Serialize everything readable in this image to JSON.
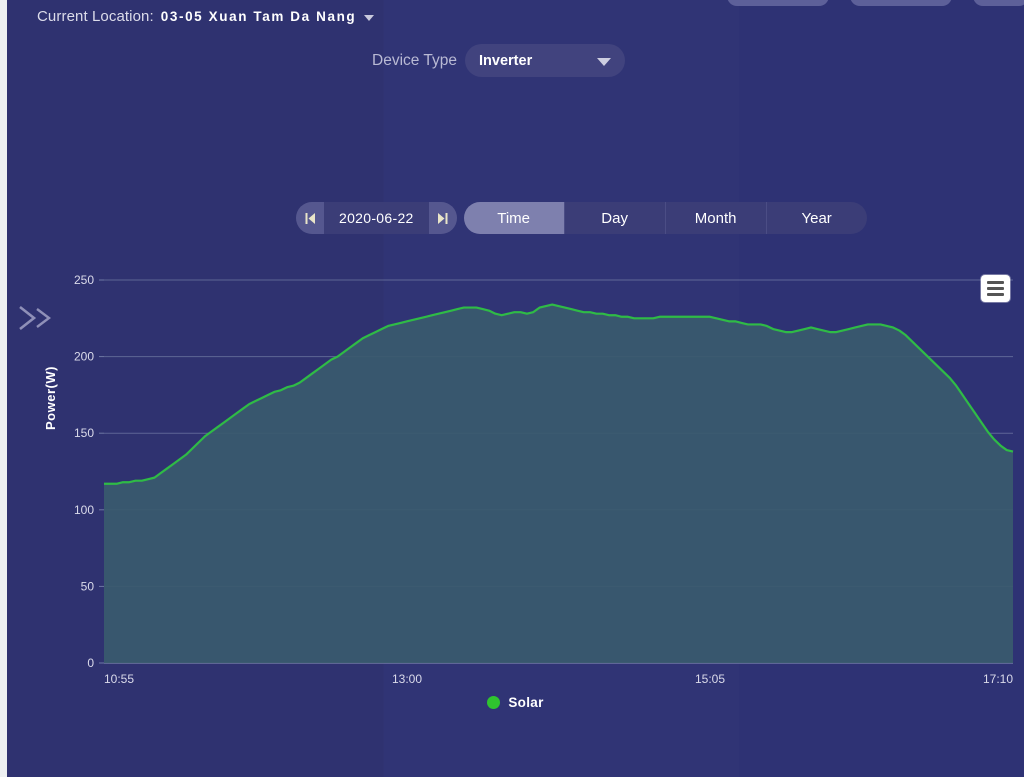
{
  "header": {
    "location_label": "Current Location:",
    "location_value": "03-05 Xuan Tam Da Nang",
    "location_caret_icon": "chevron-down-icon",
    "device_type_label": "Device Type",
    "device_type_value": "Inverter",
    "device_type_caret_icon": "chevron-down-icon"
  },
  "controls": {
    "prev_icon": "step-backward-icon",
    "next_icon": "step-forward-icon",
    "date_value": "2020-06-22",
    "tabs": [
      {
        "label": "Time",
        "active": true
      },
      {
        "label": "Day",
        "active": false
      },
      {
        "label": "Month",
        "active": false
      },
      {
        "label": "Year",
        "active": false
      }
    ]
  },
  "sidebar": {
    "expander_icon": "double-chevron-right-icon"
  },
  "chart_menu": {
    "icon": "hamburger-menu-icon"
  },
  "colors": {
    "background": "#2e3174",
    "area_fill": "#3a5a6e",
    "line": "#2fbb46",
    "legend_dot": "#2fc42f",
    "gridline": "#9aa7c4",
    "accent_tab": "#7e80ae"
  },
  "chart_data": {
    "type": "area",
    "title": "",
    "xlabel": "",
    "ylabel": "Power(W)",
    "ylim": [
      0,
      250
    ],
    "yticks": [
      0,
      50,
      100,
      150,
      200,
      250
    ],
    "xticks": [
      "10:55",
      "13:00",
      "15:05",
      "17:10"
    ],
    "grid": true,
    "legend_position": "bottom",
    "series": [
      {
        "name": "Solar",
        "color": "#2fbb46",
        "x_start": "10:55",
        "x_end": "17:10",
        "values": [
          117,
          117,
          117,
          118,
          118,
          119,
          119,
          120,
          121,
          124,
          127,
          130,
          133,
          136,
          140,
          144,
          148,
          151,
          154,
          157,
          160,
          163,
          166,
          169,
          171,
          173,
          175,
          177,
          178,
          180,
          181,
          183,
          186,
          189,
          192,
          195,
          198,
          200,
          203,
          206,
          209,
          212,
          214,
          216,
          218,
          220,
          221,
          222,
          223,
          224,
          225,
          226,
          227,
          228,
          229,
          230,
          231,
          232,
          232,
          232,
          231,
          230,
          228,
          227,
          228,
          229,
          229,
          228,
          229,
          232,
          233,
          234,
          233,
          232,
          231,
          230,
          229,
          229,
          228,
          228,
          227,
          227,
          226,
          226,
          225,
          225,
          225,
          225,
          226,
          226,
          226,
          226,
          226,
          226,
          226,
          226,
          226,
          225,
          224,
          223,
          223,
          222,
          221,
          221,
          221,
          220,
          218,
          217,
          216,
          216,
          217,
          218,
          219,
          218,
          217,
          216,
          216,
          217,
          218,
          219,
          220,
          221,
          221,
          221,
          220,
          219,
          217,
          214,
          210,
          206,
          202,
          198,
          194,
          190,
          186,
          181,
          175,
          169,
          163,
          157,
          151,
          146,
          142,
          139,
          138
        ]
      }
    ]
  }
}
